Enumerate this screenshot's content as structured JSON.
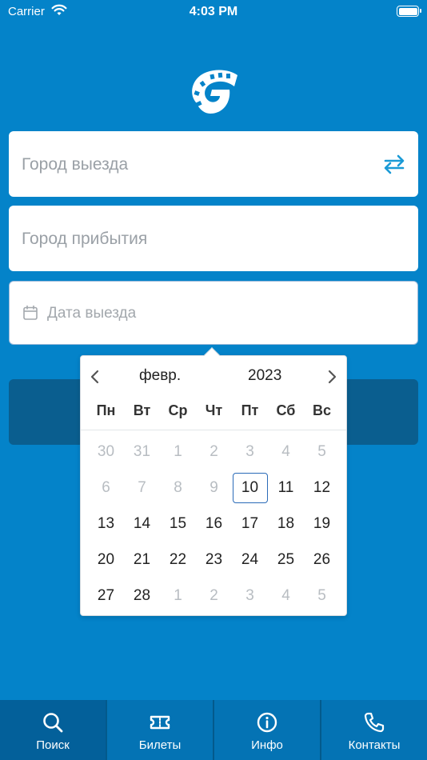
{
  "status_bar": {
    "carrier": "Carrier",
    "time": "4:03 PM"
  },
  "form": {
    "from_placeholder": "Город выезда",
    "to_placeholder": "Город прибытия",
    "date_placeholder": "Дата выезда"
  },
  "datepicker": {
    "month": "февр.",
    "year": "2023",
    "weekdays": [
      "Пн",
      "Вт",
      "Ср",
      "Чт",
      "Пт",
      "Сб",
      "Вс"
    ],
    "weeks": [
      [
        "30",
        "31",
        "1",
        "2",
        "3",
        "4",
        "5"
      ],
      [
        "6",
        "7",
        "8",
        "9",
        "10",
        "11",
        "12"
      ],
      [
        "13",
        "14",
        "15",
        "16",
        "17",
        "18",
        "19"
      ],
      [
        "20",
        "21",
        "22",
        "23",
        "24",
        "25",
        "26"
      ],
      [
        "27",
        "28",
        "1",
        "2",
        "3",
        "4",
        "5"
      ]
    ],
    "selected_day": "10"
  },
  "tabbar": {
    "items": [
      {
        "label": "Поиск",
        "icon": "search-icon"
      },
      {
        "label": "Билеты",
        "icon": "ticket-icon"
      },
      {
        "label": "Инфо",
        "icon": "info-icon"
      },
      {
        "label": "Контакты",
        "icon": "phone-icon"
      }
    ],
    "active": "Поиск"
  },
  "colors": {
    "background": "#0483c9",
    "accent": "#1a9ad6",
    "search_button": "#0a5e8f",
    "tabbar": "#0473b4",
    "tabbar_active": "#03609a"
  }
}
